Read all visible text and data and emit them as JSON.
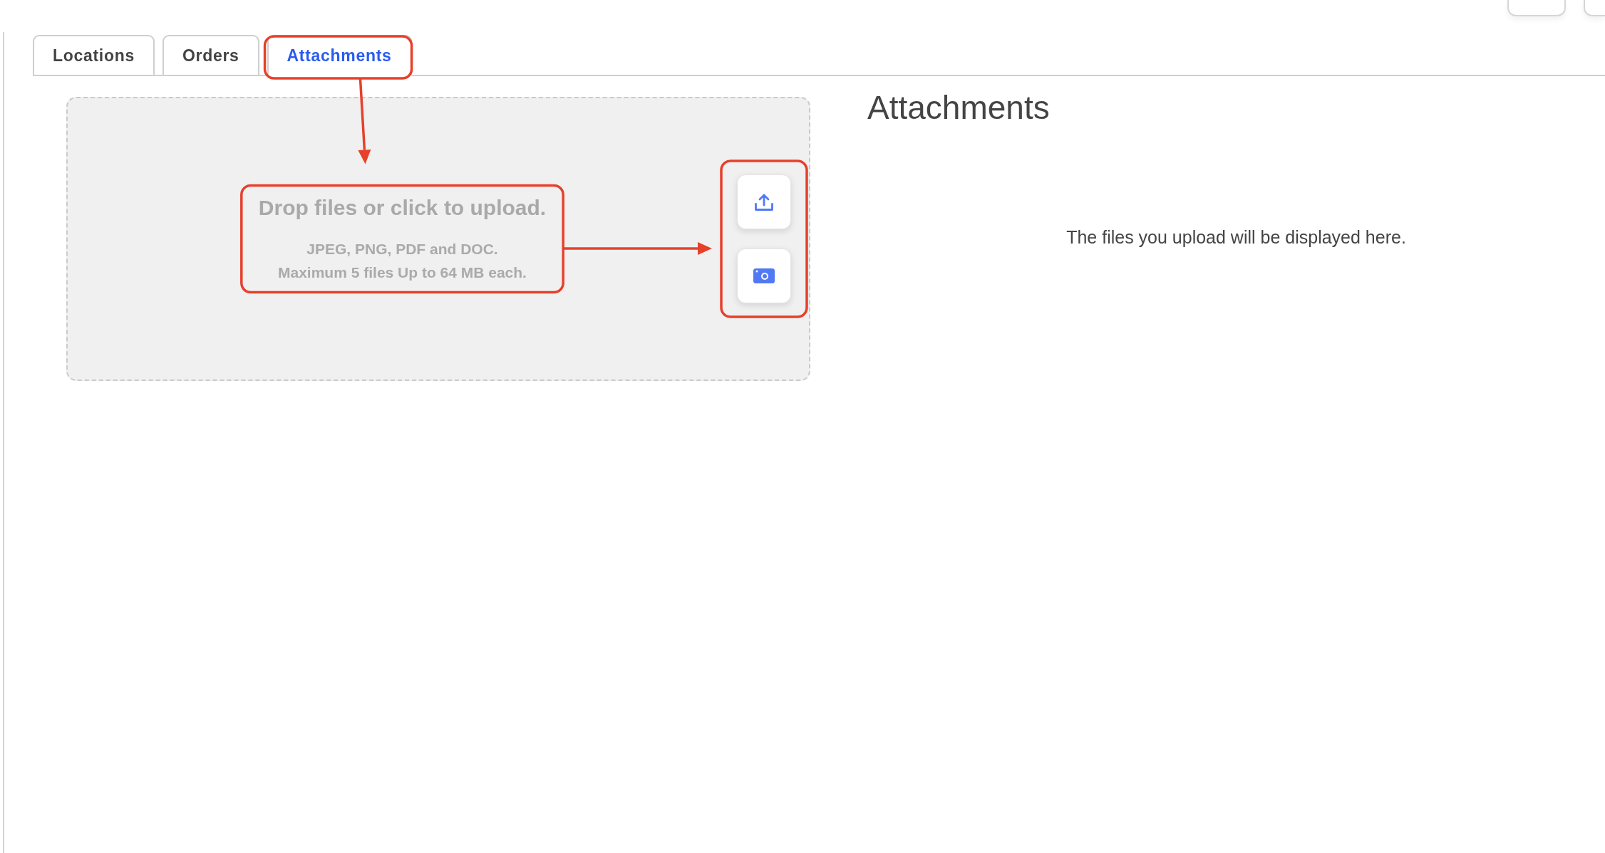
{
  "tabs": [
    {
      "label": "Locations",
      "selected": false
    },
    {
      "label": "Orders",
      "selected": false
    },
    {
      "label": "Attachments",
      "selected": true
    }
  ],
  "dropzone": {
    "title": "Drop files or click to upload.",
    "formats": "JPEG, PNG, PDF and DOC.",
    "limits": "Maximum 5 files Up to 64 MB each.",
    "buttons": [
      {
        "kind": "upload"
      },
      {
        "kind": "camera"
      }
    ]
  },
  "attachments_panel": {
    "title": "Attachments",
    "empty_message": "The files you upload will be displayed here."
  }
}
